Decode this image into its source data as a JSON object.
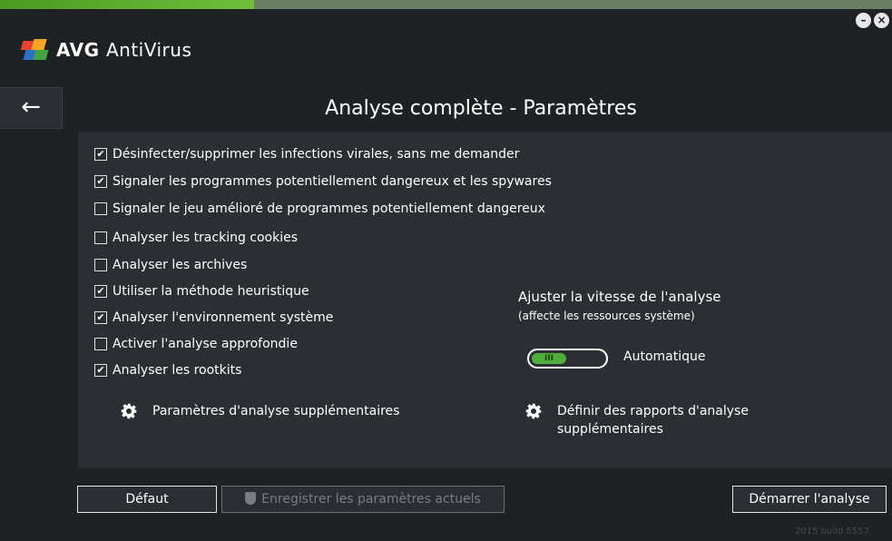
{
  "app": {
    "logo_brand": "AVG",
    "logo_product": "AntiVirus",
    "minimize_glyph": "–",
    "close_glyph": "×",
    "back_glyph": "←",
    "version": "2015  build 5557"
  },
  "page": {
    "title": "Analyse complète - Paramètres"
  },
  "options": [
    {
      "label": "Désinfecter/supprimer les infections virales, sans me demander",
      "checked": true
    },
    {
      "label": "Signaler les programmes potentiellement dangereux et les spywares",
      "checked": true
    },
    {
      "label": "Signaler le jeu amélioré de programmes potentiellement dangereux",
      "checked": false
    },
    {
      "label": "Analyser les tracking cookies",
      "checked": false
    },
    {
      "label": "Analyser les archives",
      "checked": false
    },
    {
      "label": "Utiliser la méthode heuristique",
      "checked": true
    },
    {
      "label": "Analyser l'environnement système",
      "checked": true
    },
    {
      "label": "Activer l'analyse approfondie",
      "checked": false
    },
    {
      "label": "Analyser les rootkits",
      "checked": true
    }
  ],
  "speed": {
    "title": "Ajuster la vitesse de l'analyse",
    "subtitle": "(affecte les ressources système)",
    "slider_marks": "III",
    "value": "Automatique"
  },
  "links": {
    "additional_settings": "Paramètres d'analyse supplémentaires",
    "reports_line1": "Définir des rapports d'analyse",
    "reports_line2": "supplémentaires"
  },
  "buttons": {
    "default": "Défaut",
    "save_current": "Enregistrer les paramètres actuels",
    "start": "Démarrer l'analyse"
  },
  "colors": {
    "accent_green": "#4fae3a",
    "background": "#1f2225",
    "panel": "#2b2f33"
  }
}
